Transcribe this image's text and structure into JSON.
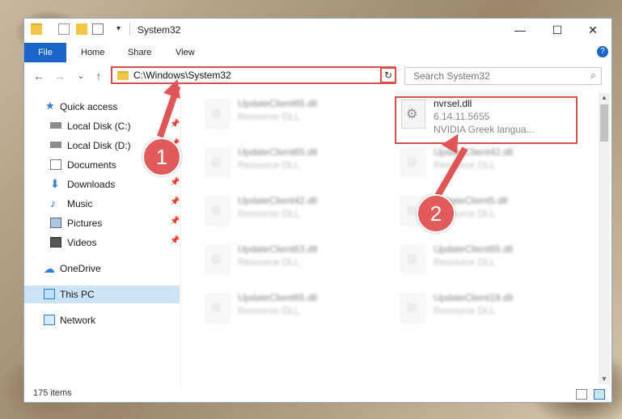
{
  "window": {
    "title": "System32",
    "controls": [
      "—",
      "☐",
      "✕"
    ]
  },
  "ribbon": {
    "tabs": [
      "File",
      "Home",
      "Share",
      "View"
    ],
    "help": "?"
  },
  "navigation": {
    "back": "←",
    "forward": "→",
    "recent": "⌄",
    "up": "↑",
    "address_path": "C:\\Windows\\System32",
    "search_placeholder": "Search System32"
  },
  "sidebar": {
    "items": [
      {
        "label": "Quick access",
        "icon": "star-icon"
      },
      {
        "label": "Local Disk (C:)",
        "icon": "drive-icon"
      },
      {
        "label": "Local Disk (D:)",
        "icon": "drive-icon"
      },
      {
        "label": "Documents",
        "icon": "documents-icon"
      },
      {
        "label": "Downloads",
        "icon": "download-icon"
      },
      {
        "label": "Music",
        "icon": "music-icon"
      },
      {
        "label": "Pictures",
        "icon": "pictures-icon"
      },
      {
        "label": "Videos",
        "icon": "videos-icon"
      },
      {
        "label": "OneDrive",
        "icon": "cloud-icon"
      },
      {
        "label": "This PC",
        "icon": "pc-icon"
      },
      {
        "label": "Network",
        "icon": "network-icon"
      }
    ]
  },
  "files": {
    "highlighted": {
      "name": "nvrsel.dll",
      "version": "6.14.11.5655",
      "description": "NVIDIA Greek langua..."
    },
    "blurred_left": [
      {
        "name": "UpdateClient65.dll",
        "type": "Resource DLL"
      },
      {
        "name": "UpdateClient65.dll",
        "type": "Resource DLL"
      },
      {
        "name": "UpdateClient42.dll",
        "type": "Resource DLL"
      },
      {
        "name": "UpdateClient63.dll",
        "type": "Resource DLL"
      },
      {
        "name": "UpdateClient65.dll",
        "type": "Resource DLL"
      }
    ],
    "blurred_right": [
      {
        "name": "UpdateClient42.dll",
        "type": "Resource DLL"
      },
      {
        "name": "UpdateClient5.dll",
        "type": "Resource DLL"
      },
      {
        "name": "UpdateClient65.dll",
        "type": "Resource DLL"
      },
      {
        "name": "UpdateClient19.dll",
        "type": "Resource DLL"
      }
    ]
  },
  "status": {
    "item_count": "175 items"
  },
  "callouts": [
    "1",
    "2"
  ],
  "colors": {
    "accent": "#1a65c9",
    "highlight_red": "#d9504a",
    "selection": "#cce4f7"
  }
}
